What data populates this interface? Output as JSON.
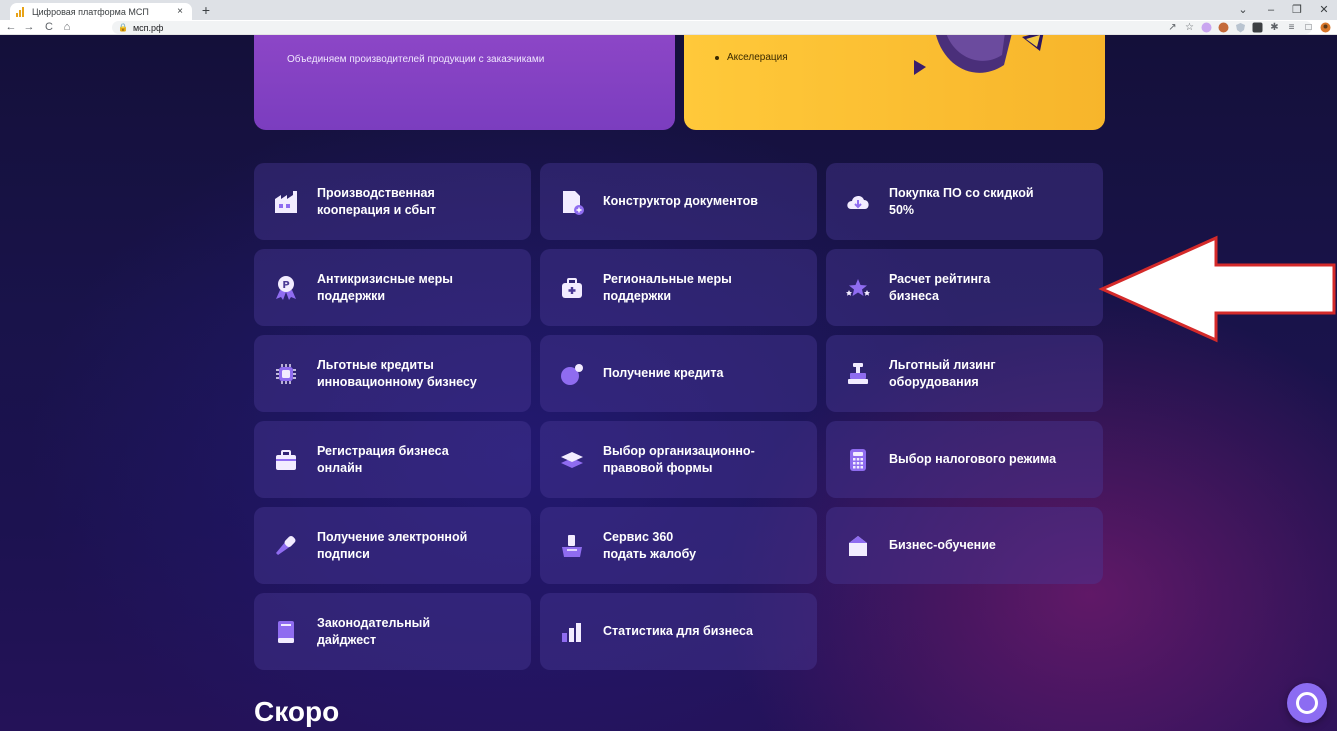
{
  "browser": {
    "tab_title": "Цифровая платформа МСП",
    "tab_close": "×",
    "new_tab": "+",
    "url": "мсп.рф",
    "back": "←",
    "forward": "→",
    "reload": "C",
    "home": "⌂",
    "window": {
      "minimize": "–",
      "maximize": "❐",
      "close": "✕",
      "dropdown": "⌄"
    }
  },
  "promos": {
    "purple": {
      "text": "Объединяем производителей продукции с заказчиками"
    },
    "yellow": {
      "bullet": "Акселерация"
    }
  },
  "services": [
    {
      "label": "Производственная\nкооперация и сбыт",
      "icon": "factory-icon"
    },
    {
      "label": "Конструктор документов",
      "icon": "document-icon"
    },
    {
      "label": "Покупка ПО со скидкой\n50%",
      "icon": "cloud-download-icon"
    },
    {
      "label": "Антикризисные меры\nподдержки",
      "icon": "ruble-badge-icon"
    },
    {
      "label": "Региональные меры\nподдержки",
      "icon": "first-aid-kit-icon"
    },
    {
      "label": "Расчет рейтинга\nбизнеса",
      "icon": "stars-icon"
    },
    {
      "label": "Льготные кредиты\nинновационному бизнесу",
      "icon": "chip-icon"
    },
    {
      "label": "Получение кредита",
      "icon": "sphere-icon"
    },
    {
      "label": "Льготный лизинг\nоборудования",
      "icon": "machine-icon"
    },
    {
      "label": "Регистрация бизнеса\nонлайн",
      "icon": "briefcase-icon"
    },
    {
      "label": "Выбор организационно-\nправовой формы",
      "icon": "layers-icon"
    },
    {
      "label": "Выбор налогового режима",
      "icon": "calculator-icon"
    },
    {
      "label": "Получение электронной\nподписи",
      "icon": "usb-key-icon"
    },
    {
      "label": "Сервис 360\nподать жалобу",
      "icon": "complaint-icon"
    },
    {
      "label": "Бизнес-обучение",
      "icon": "academy-icon"
    },
    {
      "label": "Законодательный\nдайджест",
      "icon": "book-icon"
    },
    {
      "label": "Статистика для бизнеса",
      "icon": "bar-chart-icon"
    }
  ],
  "next_section_title": "Скоро",
  "colors": {
    "card_bg": "#4b3a96",
    "icon_light": "#f2ecff",
    "icon_accent": "#8f6cf0",
    "arrow_stroke": "#d42a2a"
  }
}
